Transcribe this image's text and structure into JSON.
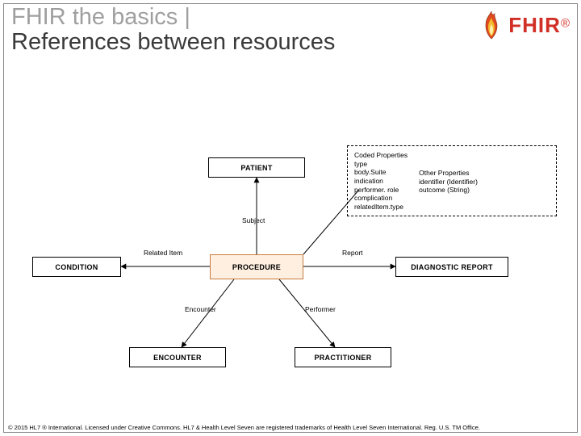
{
  "header": {
    "breadcrumb": "FHIR the basics |",
    "title": "References between resources",
    "logo_text": "FHIR",
    "logo_reg": "®"
  },
  "boxes": {
    "patient": "PATIENT",
    "condition": "CONDITION",
    "procedure": "PROCEDURE",
    "diagnostic": "DIAGNOSTIC REPORT",
    "encounter": "ENCOUNTER",
    "practitioner": "PRACTITIONER"
  },
  "edges": {
    "subject": "Subject",
    "related_item": "Related Item",
    "report": "Report",
    "encounter": "Encounter",
    "performer": "Performer"
  },
  "note": {
    "coded_header": "Coded Properties",
    "coded_items": [
      "type",
      "body.Suite",
      "indication",
      "performer. role",
      "complication",
      "relatedItem.type"
    ],
    "other_header": "Other Properties",
    "other_items": [
      "identifier (Identifier)",
      "outcome (String)"
    ]
  },
  "footer": "© 2015 HL7 ® International. Licensed under Creative Commons. HL7 & Health Level Seven are registered trademarks of Health Level Seven International. Reg. U.S. TM Office."
}
